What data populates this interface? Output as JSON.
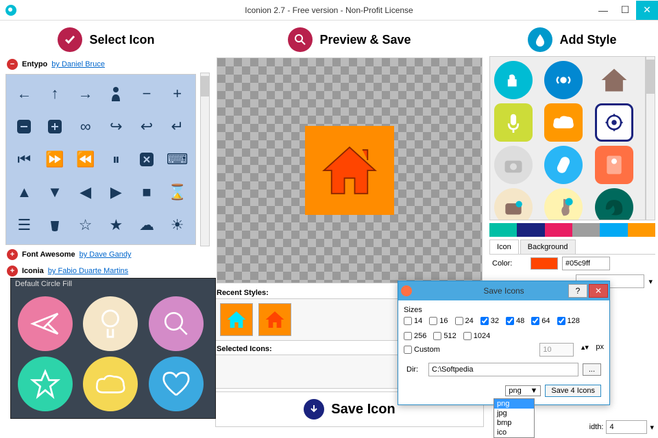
{
  "window": {
    "title": "Iconion 2.7 - Free version - Non-Profit License"
  },
  "sections": {
    "select": "Select Icon",
    "preview": "Preview & Save",
    "style": "Add Style"
  },
  "iconsets": {
    "entypo": {
      "name": "Entypo",
      "author": "by Daniel Bruce"
    },
    "fontawesome": {
      "name": "Font Awesome",
      "author": "by Dave Gandy"
    },
    "iconia": {
      "name": "Iconia",
      "author": "by Fabio Duarte Martins"
    }
  },
  "preview": {
    "recent_label": "Recent Styles:",
    "selected_label": "Selected Icons:",
    "save_label": "Save Icon"
  },
  "tooltip": {
    "title": "Default Circle Fill"
  },
  "style_panel": {
    "tab_icon": "Icon",
    "tab_bg": "Background",
    "color_label": "Color:",
    "color_value": "#05c9ff",
    "width_label": "idth:",
    "width_value": "4",
    "colors": [
      "#00bfa5",
      "#1a237e",
      "#e91e63",
      "#9e9e9e",
      "#03a9f4",
      "#ff9800"
    ]
  },
  "dialog": {
    "title": "Save Icons",
    "sizes_label": "Sizes",
    "sizes": [
      {
        "v": "14",
        "c": false
      },
      {
        "v": "16",
        "c": false
      },
      {
        "v": "24",
        "c": false
      },
      {
        "v": "32",
        "c": true
      },
      {
        "v": "48",
        "c": true
      },
      {
        "v": "64",
        "c": true
      },
      {
        "v": "128",
        "c": true
      },
      {
        "v": "256",
        "c": false
      },
      {
        "v": "512",
        "c": false
      },
      {
        "v": "1024",
        "c": false
      }
    ],
    "custom_label": "Custom",
    "custom_value": "10",
    "custom_unit": "px",
    "dir_label": "Dir:",
    "dir_value": "C:\\Softpedia",
    "save_btn": "Save 4 Icons",
    "format_selected": "png",
    "formats": [
      "png",
      "jpg",
      "bmp",
      "ico"
    ]
  }
}
